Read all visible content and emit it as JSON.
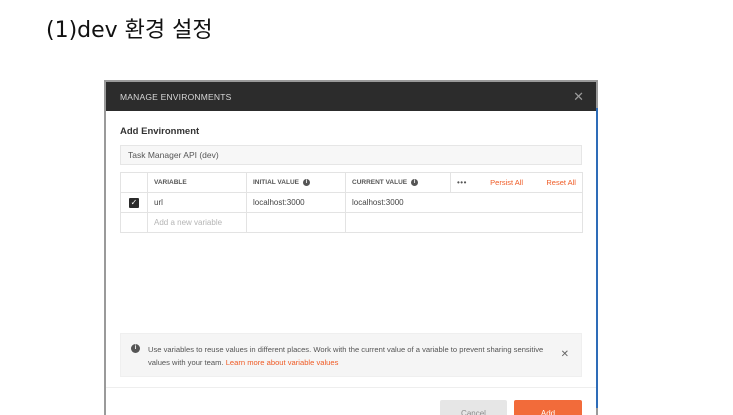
{
  "doc": {
    "heading": "(1)dev 환경 설정"
  },
  "modal": {
    "title": "MANAGE ENVIRONMENTS",
    "section_title": "Add Environment",
    "env_name": "Task Manager API (dev)",
    "table": {
      "headers": {
        "variable": "VARIABLE",
        "initial": "INITIAL VALUE",
        "current": "CURRENT VALUE"
      },
      "more": "•••",
      "persist_all": "Persist All",
      "reset_all": "Reset All",
      "rows": [
        {
          "checked": true,
          "variable": "url",
          "initial": "localhost:3000",
          "current": "localhost:3000"
        }
      ],
      "new_placeholder": "Add a new variable"
    },
    "info": {
      "text": "Use variables to reuse values in different places. Work with the current value of a variable to prevent sharing sensitive values with your team.",
      "link": "Learn more about variable values"
    },
    "buttons": {
      "cancel": "Cancel",
      "add": "Add"
    }
  },
  "icons": {
    "close": "close-icon",
    "info": "info-icon",
    "check": "checkbox-checked-icon",
    "cursor": "mouse-pointer-icon"
  },
  "colors": {
    "accent": "#f26b3a",
    "header": "#2c2c2c",
    "link": "#ef5b25"
  }
}
